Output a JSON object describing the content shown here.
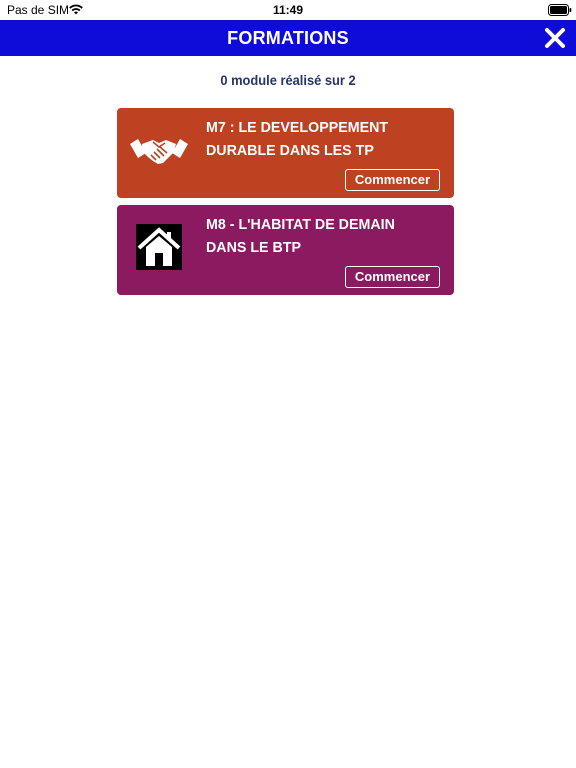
{
  "status_bar": {
    "carrier": "Pas de SIM",
    "time": "11:49",
    "wifi_icon": "wifi-icon",
    "battery_icon": "battery-icon"
  },
  "nav": {
    "title": "FORMATIONS",
    "close_icon": "close-icon",
    "background_color": "#0f0bd9"
  },
  "progress": {
    "text": "0 module réalisé sur 2",
    "completed": 0,
    "total": 2
  },
  "modules": [
    {
      "title": "M7 : LE DEVELOPPEMENT DURABLE DANS LES TP",
      "button_label": "Commencer",
      "icon": "handshake-icon",
      "color": "#be4222"
    },
    {
      "title": "M8 - L'HABITAT DE DEMAIN DANS LE BTP",
      "button_label": "Commencer",
      "icon": "house-icon",
      "color": "#8c1a60"
    }
  ]
}
